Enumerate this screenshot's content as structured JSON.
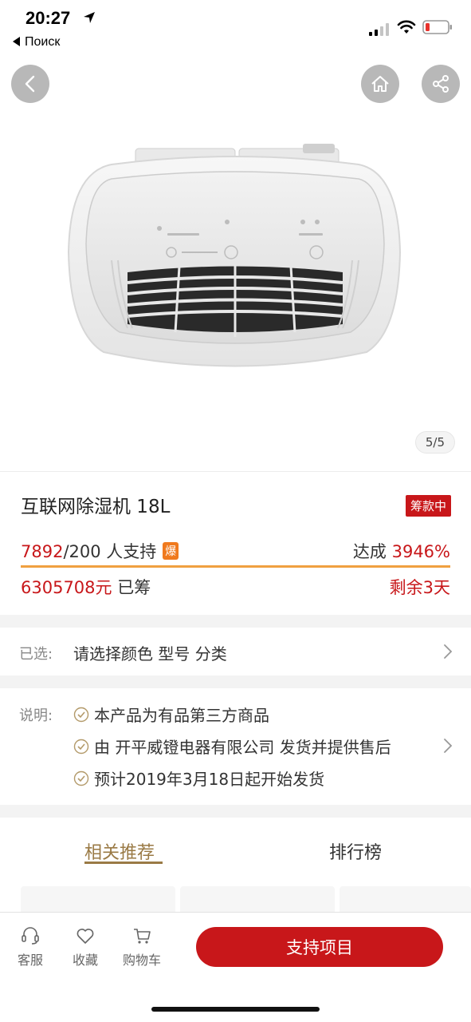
{
  "status_bar": {
    "time": "20:27",
    "back_app": "Поиск"
  },
  "hero": {
    "pager": "5/5"
  },
  "product": {
    "title": "互联网除湿机 18L",
    "status_badge": "筹款中",
    "supporters": "7892",
    "supporters_suffix": "/200 人支持",
    "hot_badge": "爆",
    "reached_label": "达成 ",
    "reached_value": "3946%",
    "progress_percent": 100,
    "raised_value": "6305708元",
    "raised_suffix": " 已筹",
    "remaining": "剩余3天"
  },
  "selection": {
    "label": "已选:",
    "value": "请选择颜色 型号 分类"
  },
  "notes": {
    "label": "说明:",
    "items": [
      "本产品为有品第三方商品",
      "由 开平威镫电器有限公司 发货并提供售后",
      "预计2019年3月18日起开始发货"
    ]
  },
  "tabs": [
    {
      "label": "相关推荐",
      "active": true
    },
    {
      "label": "排行榜",
      "active": false
    }
  ],
  "bottom_bar": {
    "service": "客服",
    "favorite": "收藏",
    "cart": "购物车",
    "support_button": "支持项目"
  },
  "colors": {
    "accent_red": "#c8171a",
    "progress_orange": "#f0a040",
    "tab_gold": "#9a7a45",
    "hot_orange": "#f07a1e"
  }
}
